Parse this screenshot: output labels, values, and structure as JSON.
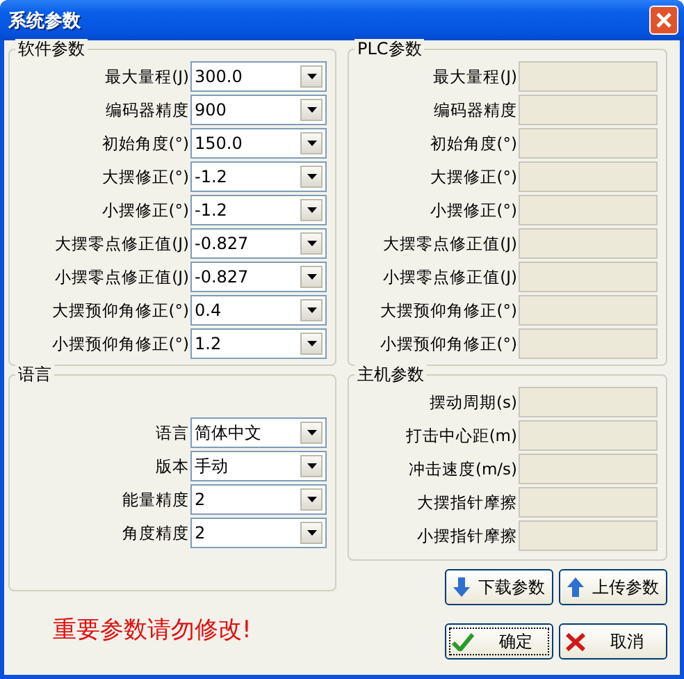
{
  "window": {
    "title": "系统参数"
  },
  "software_params": {
    "title": "软件参数",
    "rows": [
      {
        "label": "最大量程(J)",
        "value": "300.0"
      },
      {
        "label": "编码器精度",
        "value": "900"
      },
      {
        "label": "初始角度(°)",
        "value": "150.0"
      },
      {
        "label": "大摆修正(°)",
        "value": "-1.2"
      },
      {
        "label": "小摆修正(°)",
        "value": "-1.2"
      },
      {
        "label": "大摆零点修正值(J)",
        "value": "-0.827"
      },
      {
        "label": "小摆零点修正值(J)",
        "value": "-0.827"
      },
      {
        "label": "大摆预仰角修正(°)",
        "value": "0.4"
      },
      {
        "label": "小摆预仰角修正(°)",
        "value": "1.2"
      }
    ]
  },
  "plc_params": {
    "title": "PLC参数",
    "rows": [
      {
        "label": "最大量程(J)",
        "disabled": true
      },
      {
        "label": "编码器精度",
        "disabled": true
      },
      {
        "label": "初始角度(°)",
        "disabled": true
      },
      {
        "label": "大摆修正(°)",
        "disabled": true
      },
      {
        "label": "小摆修正(°)",
        "disabled": true
      },
      {
        "label": "大摆零点修正值(J)",
        "disabled": true
      },
      {
        "label": "小摆零点修正值(J)",
        "disabled": true
      },
      {
        "label": "大摆预仰角修正(°)",
        "disabled": true
      },
      {
        "label": "小摆预仰角修正(°)",
        "disabled": true
      }
    ]
  },
  "language": {
    "title": "语言",
    "rows": [
      {
        "label": "语言",
        "value": "简体中文"
      },
      {
        "label": "版本",
        "value": "手动"
      },
      {
        "label": "能量精度",
        "value": "2"
      },
      {
        "label": "角度精度",
        "value": "2"
      }
    ]
  },
  "host_params": {
    "title": "主机参数",
    "rows": [
      {
        "label": "摆动周期(s)",
        "disabled": true
      },
      {
        "label": "打击中心距(m)",
        "disabled": true
      },
      {
        "label": "冲击速度(m/s)",
        "disabled": true
      },
      {
        "label": "大摆指针摩擦",
        "disabled": true
      },
      {
        "label": "小摆指针摩擦",
        "disabled": true
      }
    ]
  },
  "warning": "重要参数请勿修改!",
  "buttons": [
    {
      "label": "下载参数",
      "kind": "download",
      "focused": false
    },
    {
      "label": "上传参数",
      "kind": "upload",
      "focused": false
    },
    {
      "label": "确定",
      "kind": "ok",
      "focused": true
    },
    {
      "label": "取消",
      "kind": "cancel",
      "focused": false
    }
  ]
}
